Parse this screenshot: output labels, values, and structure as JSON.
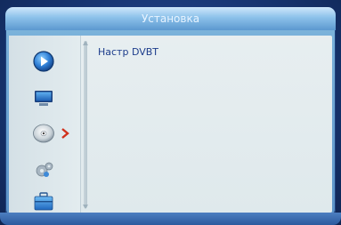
{
  "window": {
    "title": "Установка"
  },
  "sidebar": {
    "items": [
      {
        "icon": "play-icon"
      },
      {
        "icon": "tv-icon"
      },
      {
        "icon": "satellite-dish-icon",
        "selected": true
      },
      {
        "icon": "gears-icon"
      },
      {
        "icon": "toolbox-icon"
      }
    ]
  },
  "main": {
    "items": [
      {
        "label": "Настр DVBT"
      }
    ]
  },
  "colors": {
    "title_bar": "#8cc1ea",
    "frame": "#5b93c8",
    "panel": "#e3ecef",
    "text": "#1d3d8c",
    "arrow": "#d0321d"
  }
}
